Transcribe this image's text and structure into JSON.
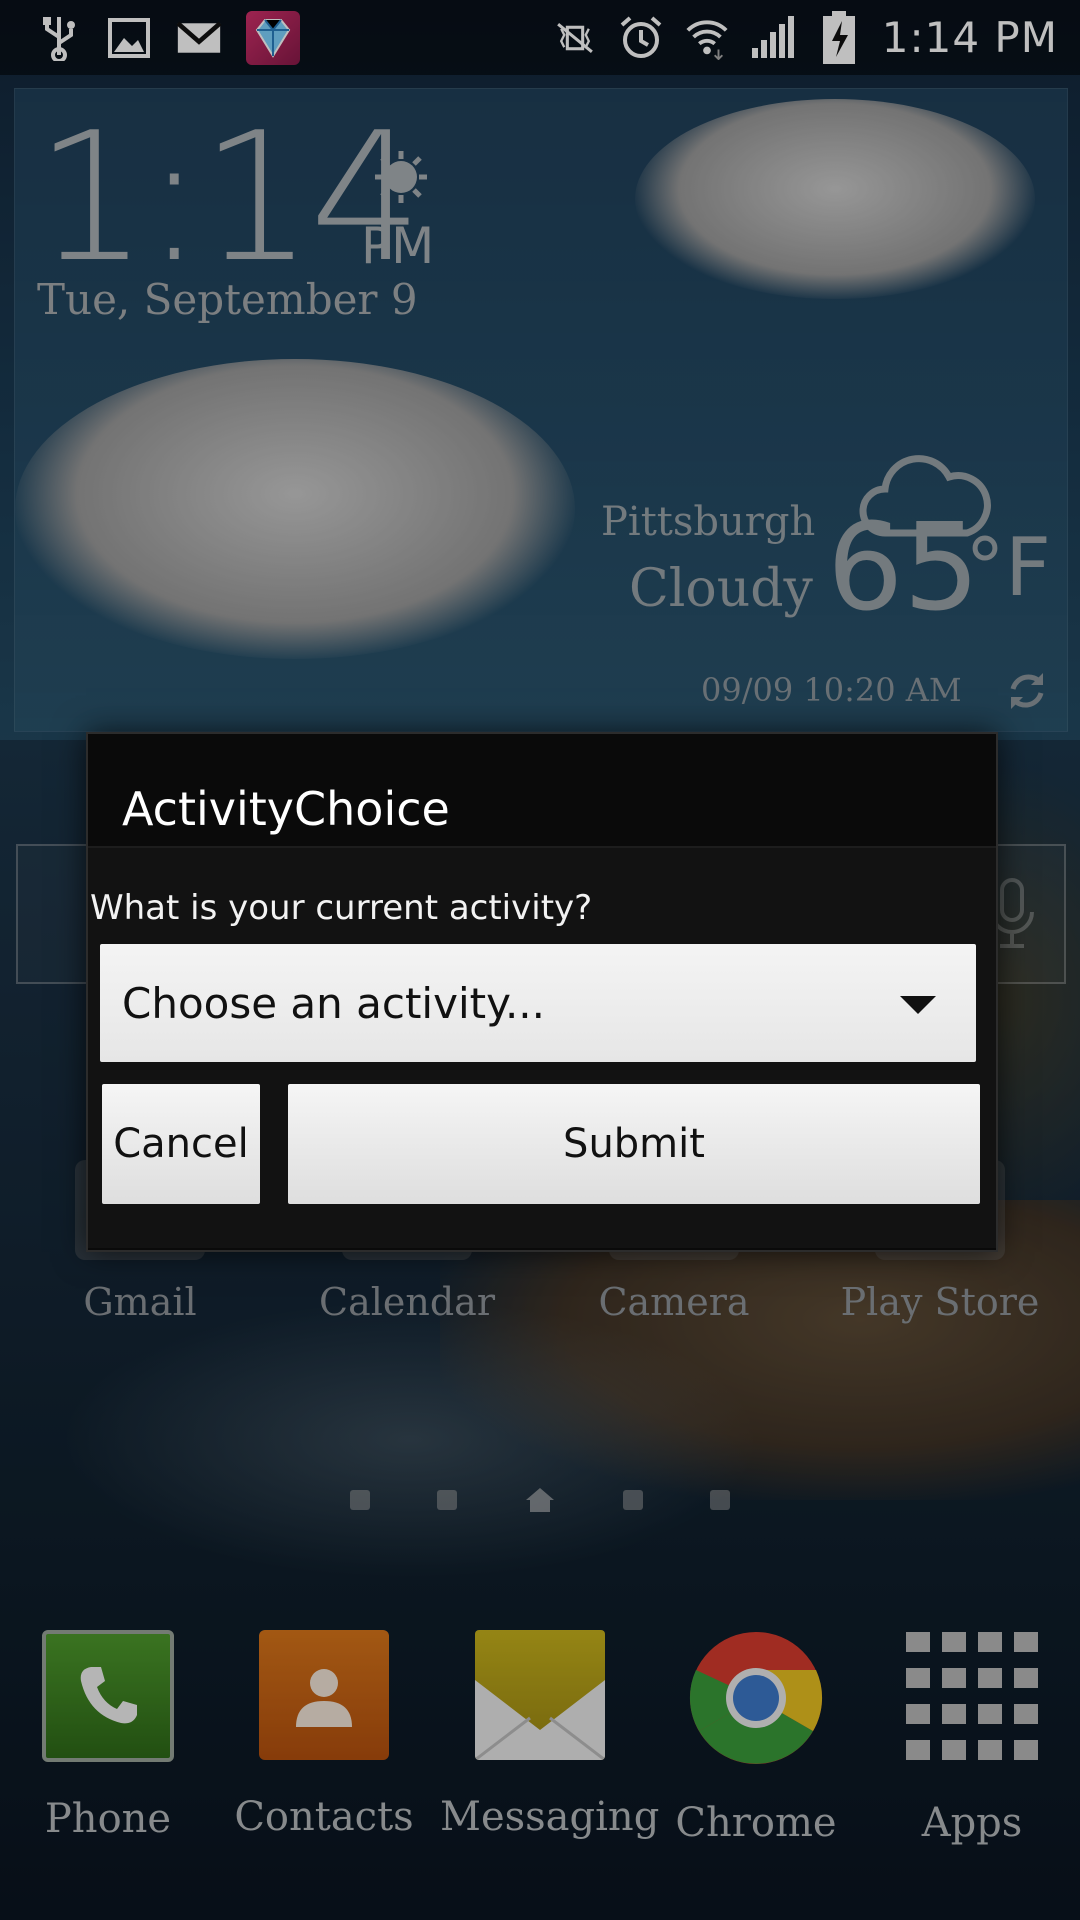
{
  "status_bar": {
    "time": "1:14 PM",
    "left_icons": [
      "usb-icon",
      "image-icon",
      "gmail-icon",
      "game-gem-icon"
    ],
    "right_icons": [
      "vibrate-mute-icon",
      "alarm-icon",
      "wifi-icon",
      "signal-icon",
      "battery-charging-icon"
    ]
  },
  "weather_widget": {
    "time": "1:14",
    "ampm": "PM",
    "date": "Tue, September 9",
    "city": "Pittsburgh",
    "condition": "Cloudy",
    "temperature": "65",
    "unit": "°F",
    "updated": "09/09 10:20 AM"
  },
  "home_apps": [
    {
      "label": "Gmail"
    },
    {
      "label": "Calendar"
    },
    {
      "label": "Camera"
    },
    {
      "label": "Play Store"
    }
  ],
  "dock": [
    {
      "label": "Phone"
    },
    {
      "label": "Contacts"
    },
    {
      "label": "Messaging"
    },
    {
      "label": "Chrome"
    },
    {
      "label": "Apps"
    }
  ],
  "dialog": {
    "title": "ActivityChoice",
    "question": "What is your current activity?",
    "spinner_value": "Choose an activity...",
    "cancel_label": "Cancel",
    "submit_label": "Submit"
  },
  "colors": {
    "dialog_bg": "#0a0a0a",
    "button_bg": "#e6e6e6",
    "text_muted": "#9aa3a8"
  }
}
